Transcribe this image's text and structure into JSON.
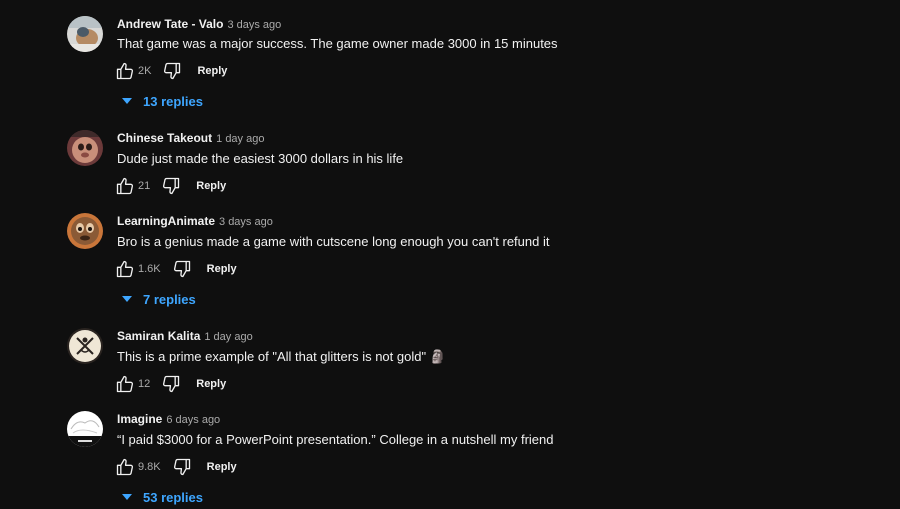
{
  "colors": {
    "background": "#0f0f0f",
    "text": "#f1f1f1",
    "secondary_text": "#aaaaaa",
    "link_blue": "#3ea6ff"
  },
  "comments": [
    {
      "author": "Andrew Tate - Valo",
      "time": "3 days ago",
      "text": "That game was a major success. The game owner made 3000 in 15 minutes",
      "likes": "2K",
      "reply_label": "Reply",
      "replies_label": "13 replies",
      "avatar_icon": "avatar-photo"
    },
    {
      "author": "Chinese Takeout",
      "time": "1 day ago",
      "text": "Dude just made the easiest 3000 dollars in his life",
      "likes": "21",
      "reply_label": "Reply",
      "avatar_icon": "avatar-photo"
    },
    {
      "author": "LearningAnimate",
      "time": "3 days ago",
      "text": "Bro is a genius made a game with cutscene long enough you can't refund it",
      "likes": "1.6K",
      "reply_label": "Reply",
      "replies_label": "7 replies",
      "avatar_icon": "avatar-photo"
    },
    {
      "author": "Samiran Kalita",
      "time": "1 day ago",
      "text": "This is a prime example of \"All that glitters is not gold\" 🗿",
      "likes": "12",
      "reply_label": "Reply",
      "avatar_icon": "avatar-photo"
    },
    {
      "author": "Imagine",
      "time": "6 days ago",
      "text": "“I paid $3000 for a PowerPoint presentation.” College in a nutshell my friend",
      "likes": "9.8K",
      "reply_label": "Reply",
      "replies_label": "53 replies",
      "avatar_icon": "avatar-photo"
    }
  ]
}
